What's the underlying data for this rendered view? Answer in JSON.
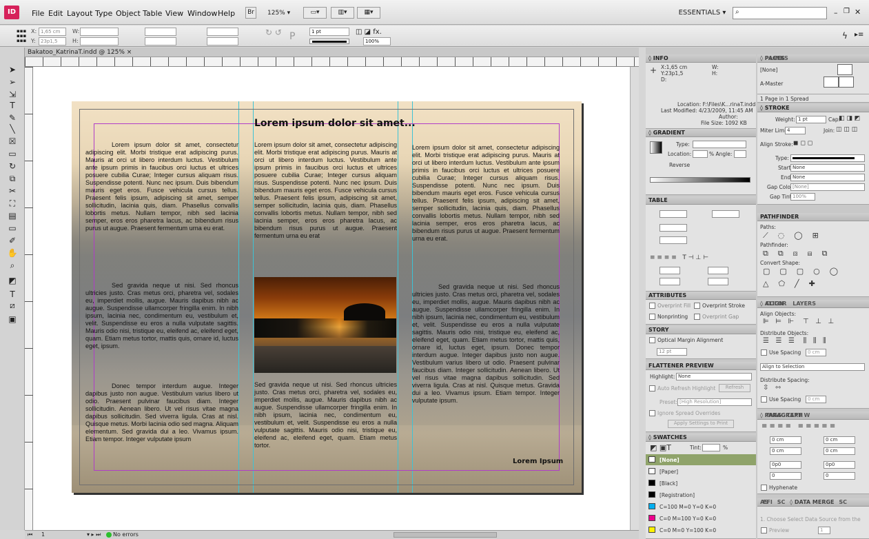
{
  "app": {
    "logo": "ID",
    "doc_tab": "Bakatoo_KatrinaT.indd @ 125% ×",
    "zoom": "125% ▾"
  },
  "menu": [
    "File",
    "Edit",
    "Layout",
    "Type",
    "Object",
    "Table",
    "View",
    "Window",
    "Help"
  ],
  "workspace": "ESSENTIALS ▾",
  "control": {
    "x": "X:",
    "x_val": "1,65 cm",
    "y": "Y:",
    "y_val": "23p1,5",
    "w": "W:",
    "h": "H:",
    "stroke_weight": "1 pt",
    "scale": "100%"
  },
  "document": {
    "headline": "Lorem ipsum dolor sit amet...",
    "col1_p1": "Lorem ipsum dolor sit amet, consectetur adipiscing elit. Morbi tristique erat adipiscing purus. Mauris at orci ut libero interdum luctus. Vestibulum ante ipsum primis in faucibus orci luctus et ultrices posuere cubilia Curae; Integer cursus aliquam risus. Suspendisse potenti. Nunc nec ipsum. Duis bibendum mauris eget eros. Fusce vehicula cursus tellus. Praesent felis ipsum, adipiscing sit amet, semper sollicitudin, lacinia quis, diam. Phasellus convallis lobortis metus. Nullam tempor, nibh sed lacinia semper, eros eros pharetra lacus, ac bibendum risus purus ut augue. Praesent fermentum urna eu erat.",
    "col1_p2": "Sed gravida neque ut nisi. Sed rhoncus ultricies justo. Cras metus orci, pharetra vel, sodales eu, imperdiet mollis, augue. Mauris dapibus nibh ac augue. Suspendisse ullamcorper fringilla enim. In nibh ipsum, lacinia nec, condimentum eu, vestibulum et, velit. Suspendisse eu eros a nulla vulputate sagittis. Mauris odio nisi, tristique eu, eleifend ac, eleifend eget, quam. Etiam metus tortor, mattis quis, ornare id, luctus eget, ipsum.",
    "col1_p3": "Donec tempor interdum augue. Integer dapibus justo non augue. Vestibulum varius libero ut odio. Praesent pulvinar faucibus diam. Integer sollicitudin. Aenean libero. Ut vel risus vitae magna dapibus sollicitudin. Sed viverra ligula. Cras at nisl. Quisque metus. Morbi lacinia odio sed magna. Aliquam elementum. Sed gravida dui a leo. Vivamus ipsum. Etiam tempor. Integer vulputate ipsum",
    "col2_p1": "Lorem ipsum dolor sit amet, consectetur adipiscing elit. Morbi tristique erat adipiscing purus. Mauris at orci ut libero interdum luctus. Vestibulum ante ipsum primis in faucibus orci luctus et ultrices posuere cubilia Curae; Integer cursus aliquam risus. Suspendisse potenti. Nunc nec ipsum. Duis bibendum mauris eget eros. Fusce vehicula cursus tellus. Praesent felis ipsum, adipiscing sit amet, semper sollicitudin, lacinia quis, diam. Phasellus convallis lobortis metus. Nullam tempor, nibh sed lacinia semper, eros eros pharetra lacus, ac bibendum risus purus ut augue. Praesent fermentum urna eu erat",
    "col2_p2": "Sed gravida neque ut nisi. Sed rhoncus ultricies justo. Cras metus orci, pharetra vel, sodales eu, imperdiet mollis, augue. Mauris dapibus nibh ac augue. Suspendisse ullamcorper fringilla enim. In nibh ipsum, lacinia nec, condimentum eu, vestibulum et, velit. Suspendisse eu eros a nulla vulputate sagittis. Mauris odio nisi, tristique eu, eleifend ac, eleifend eget, quam. Etiam metus tortor.",
    "col3_p1": "Lorem ipsum dolor sit amet, consectetur adipiscing elit. Morbi tristique erat adipiscing purus. Mauris at orci ut libero interdum luctus. Vestibulum ante ipsum primis in faucibus orci luctus et ultrices posuere cubilia Curae; Integer cursus aliquam risus. Suspendisse potenti. Nunc nec ipsum. Duis bibendum mauris eget eros. Fusce vehicula cursus tellus. Praesent felis ipsum, adipiscing sit amet, semper sollicitudin, lacinia quis, diam. Phasellus convallis lobortis metus. Nullam tempor, nibh sed lacinia semper, eros eros pharetra lacus, ac bibendum risus purus ut augue. Praesent fermentum urna eu erat.",
    "col3_p2": "Sed gravida neque ut nisi. Sed rhoncus ultricies justo. Cras metus orci, pharetra vel, sodales eu, imperdiet mollis, augue. Mauris dapibus nibh ac augue. Suspendisse ullamcorper fringilla enim. In nibh ipsum, lacinia nec, condimentum eu, vestibulum et, velit. Suspendisse eu eros a nulla vulputate sagittis. Mauris odio nisi, tristique eu, eleifend ac, eleifend eget, quam. Etiam metus tortor, mattis quis, ornare id, luctus eget, ipsum. Donec tempor interdum augue. Integer dapibus justo non augue. Vestibulum varius libero ut odio. Praesent pulvinar faucibus diam. Integer sollicitudin. Aenean libero. Ut vel risus vitae magna dapibus sollicitudin. Sed viverra ligula. Cras at nisl. Quisque metus. Gravida dui a leo. Vivamus ipsum. Etiam tempor. Integer vulputate ipsum.",
    "footer": "Lorem Ipsum"
  },
  "status": {
    "page": "1",
    "errors": "No errors"
  },
  "panels": {
    "info": {
      "title": "◊ INFO",
      "x": "X:1,65 cm",
      "y": "Y:23p1,5",
      "d": "D:",
      "w": "W:",
      "h": "H:",
      "location": "Location: F:\\Files\\K...rinaT.indd",
      "modified": "Last Modified: 4/23/2009, 11:45 AM",
      "author": "Author:",
      "filesize": "File Size: 1092 KB"
    },
    "pages": {
      "tab1": "◊ PAGES",
      "tab2": "LINKS",
      "none": "[None]",
      "master": "A-Master",
      "count": "1 Page in 1 Spread"
    },
    "stroke": {
      "title": "◊ STROKE",
      "weight_lbl": "Weight:",
      "weight": "1 pt",
      "cap": "Cap:",
      "miter": "Miter Limit:",
      "miter_val": "4",
      "join": "Join:",
      "align": "Align Stroke:",
      "type": "Type:",
      "start": "Start:",
      "start_val": "None",
      "end": "End:",
      "end_val": "None",
      "gap": "Gap Color:",
      "gap_val": "[None]",
      "gaptint": "Gap Tint:",
      "gaptint_val": "100%"
    },
    "gradient": {
      "title": "◊ GRADIENT",
      "type": "Type:",
      "location": "Location:",
      "angle": "% Angle:",
      "reverse": "Reverse"
    },
    "table": {
      "title": "TABLE"
    },
    "pathfinder": {
      "title": "PATHFINDER",
      "paths": "Paths:",
      "pathfinder": "Pathfinder:",
      "convert": "Convert Shape:"
    },
    "attributes": {
      "title": "ATTRIBUTES",
      "overprint_fill": "Overprint Fill",
      "overprint_stroke": "Overprint Stroke",
      "nonprinting": "Nonprinting",
      "overprint_gap": "Overprint Gap"
    },
    "story": {
      "title": "STORY",
      "optical": "Optical Margin Alignment",
      "size": "12 pt"
    },
    "flattener": {
      "title": "FLATTENER PREVIEW",
      "highlight": "Highlight:",
      "highlight_val": "None",
      "autorefresh": "Auto Refresh Highlight",
      "refresh": "Refresh",
      "preset": "Preset:",
      "preset_val": "[High Resolution]",
      "ignore": "Ignore Spread Overrides",
      "apply": "Apply Settings to Print"
    },
    "align": {
      "tab1": "◊ ALIGN",
      "tab2": "COLOR",
      "tab3": "LAYERS",
      "align_obj": "Align Objects:",
      "dist_obj": "Distribute Objects:",
      "use_spacing": "Use Spacing",
      "spacing_val": "0 cm",
      "align_sel": "Align to Selection",
      "dist_spacing": "Distribute Spacing:",
      "use_spacing2": "Use Spacing",
      "spacing_val2": "0 cm"
    },
    "swatches": {
      "title": "◊ SWATCHES",
      "tint": "Tint:",
      "tint_val": "%",
      "items": [
        "[None]",
        "[Paper]",
        "[Black]",
        "[Registration]",
        "C=100 M=0 Y=0 K=0",
        "C=0 M=100 Y=0 K=0",
        "C=0 M=0 Y=100 K=0"
      ],
      "colors": [
        "#ffffff",
        "#ffffff",
        "#000000",
        "#000000",
        "#00aeef",
        "#ec008c",
        "#fff200"
      ]
    },
    "paragraph": {
      "tab1": "◊ PARAGRAPH",
      "tab2": "TAGS",
      "tab3": "TEXT W",
      "f1": "0 cm",
      "f2": "0 cm",
      "f3": "0 cm",
      "f4": "0 cm",
      "f5": "0p0",
      "f6": "0p0",
      "f7": "0",
      "f8": "0",
      "hyphenate": "Hyphenate"
    },
    "datamerge": {
      "tab1": "AS",
      "tab2": "EFI",
      "tab3": "SC",
      "tab4": "◊ DATA MERGE",
      "tab5": "SC",
      "hint": "1. Choose Select Data Source from the",
      "preview": "Preview",
      "page": "1"
    }
  }
}
